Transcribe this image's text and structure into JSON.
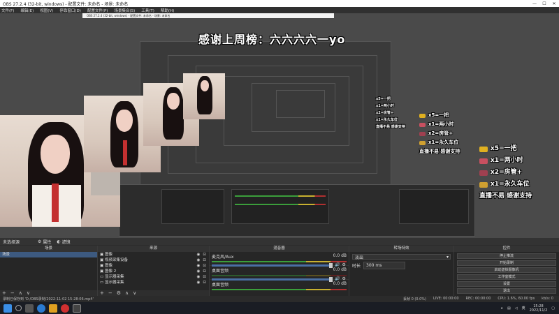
{
  "window": {
    "title": "OBS 27.2.4 (32-bit, windows) - 配置文件: 未命名 - 场景: 未命名",
    "min": "—",
    "max": "☐",
    "close": "✕"
  },
  "menu": [
    "文件(F)",
    "编辑(E)",
    "视图(V)",
    "停靠窗口(D)",
    "配置文件(P)",
    "场景集合(S)",
    "工具(T)",
    "帮助(H)"
  ],
  "preview": {
    "banner": "感谢上周榜：六六六六一yo",
    "inner_title": "OBS 27.2.4 (32-bit, windows) - 配置文件: 未命名 - 场景: 未命名",
    "gifts": [
      {
        "text": "x5=一把"
      },
      {
        "text": "x1=两小时"
      },
      {
        "text": "x2=房管+"
      },
      {
        "text": "x1=永久车位"
      },
      {
        "text": "直播不易  感谢支持"
      }
    ]
  },
  "bottombar": {
    "label": "未选择源",
    "props": "属性",
    "filters": "滤镜"
  },
  "docks": {
    "scenes": {
      "title": "场景",
      "items": [
        "场景"
      ]
    },
    "sources": {
      "title": "来源",
      "items": [
        "图像",
        "视频采集设备",
        "图像",
        "图像 2",
        "显示器采集",
        "显示器采集"
      ]
    },
    "mixer": {
      "title": "混音器",
      "tracks": [
        {
          "name": "麦克风/Aux",
          "db": "0.0 dB"
        },
        {
          "name": "桌面音频",
          "db": "0.0 dB"
        },
        {
          "name": "桌面音频",
          "db": "0.0 dB"
        }
      ]
    },
    "transitions": {
      "title": "转场特效",
      "type": "淡出",
      "duration_label": "时长",
      "duration": "300 ms"
    },
    "controls": {
      "title": "控件",
      "buttons": [
        "停止推流",
        "开始录制",
        "启动虚拟摄像机",
        "工作室模式",
        "设置",
        "退出"
      ]
    }
  },
  "status": {
    "recording": "录制已保存到 'D:/OBS录制/2022-11-02 15-28-06.mp4'",
    "dropped": "丢帧 0 (0.0%)",
    "live": "LIVE: 00:00:00",
    "rec": "REC: 00:00:00",
    "cpu": "CPU: 1.6%, 60.00 fps",
    "kbps": "kb/s: 0"
  },
  "taskbar": {
    "lang": "英",
    "time": "15:28",
    "date": "2022/11/2"
  },
  "colors": {
    "accent": "#3d5a80",
    "meter_green": "#3b9e3b",
    "meter_yellow": "#c8b030",
    "meter_red": "#b03030",
    "tie": "#c43030"
  }
}
